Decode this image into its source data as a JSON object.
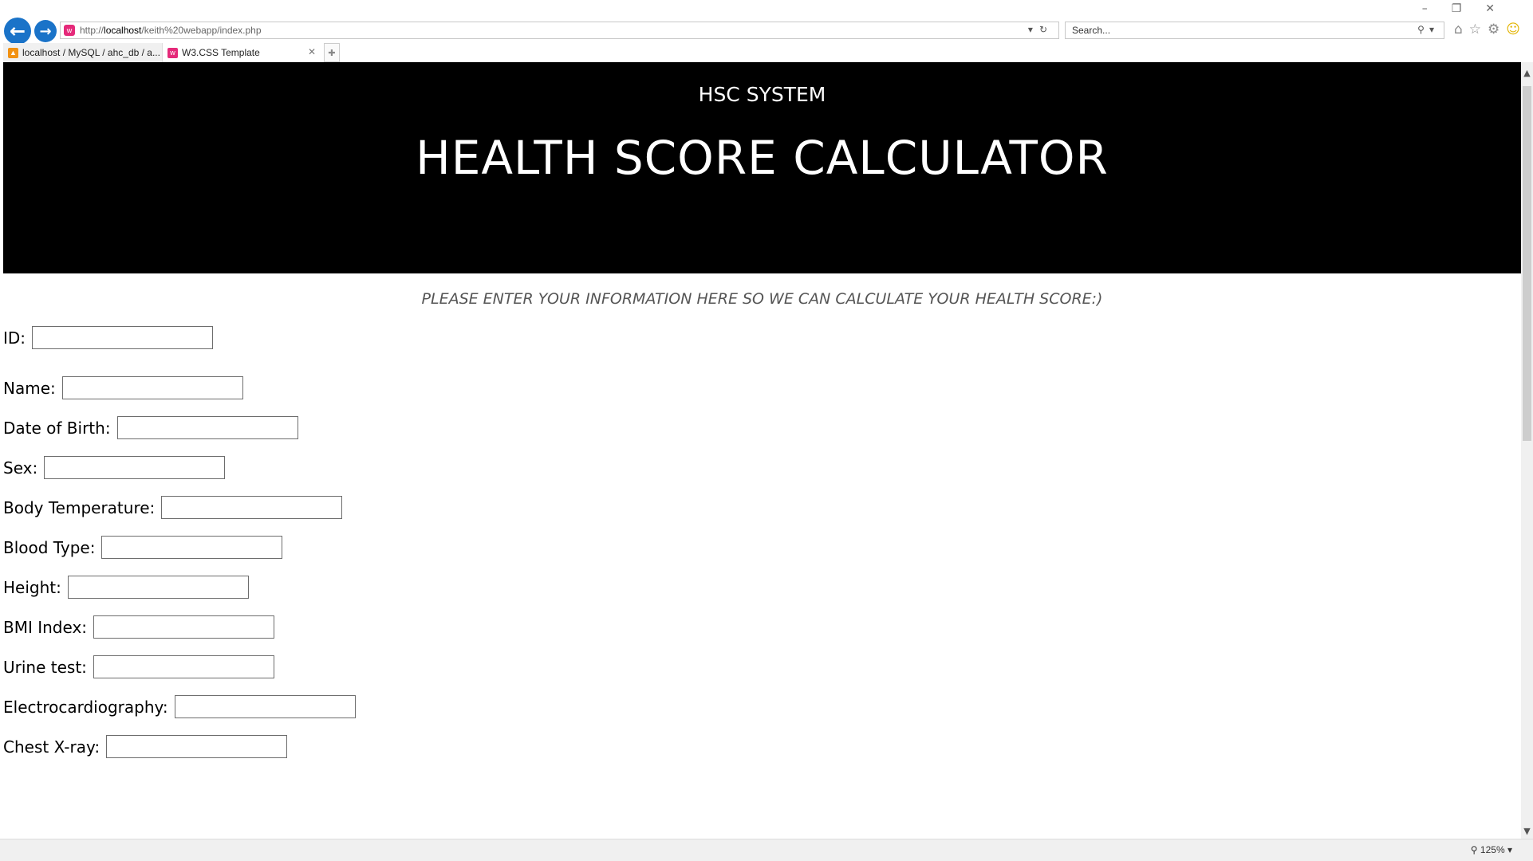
{
  "browser": {
    "address": {
      "prefix": "http://",
      "host": "localhost",
      "path": "/keith%20webapp/index.php"
    },
    "search_placeholder": "Search...",
    "tabs": [
      {
        "label": "localhost / MySQL / ahc_db / a..."
      },
      {
        "label": "W3.CSS Template"
      }
    ],
    "zoom": "125%"
  },
  "header": {
    "system": "HSC SYSTEM",
    "title": "HEALTH SCORE CALCULATOR"
  },
  "intro": "PLEASE ENTER YOUR INFORMATION HERE SO WE CAN CALCULATE YOUR HEALTH SCORE:)",
  "form": {
    "fields": [
      {
        "label": "ID:",
        "value": ""
      },
      {
        "label": "Name:",
        "value": ""
      },
      {
        "label": "Date of Birth:",
        "value": ""
      },
      {
        "label": "Sex:",
        "value": ""
      },
      {
        "label": "Body Temperature:",
        "value": ""
      },
      {
        "label": "Blood Type:",
        "value": ""
      },
      {
        "label": "Height:",
        "value": ""
      },
      {
        "label": "BMI Index:",
        "value": ""
      },
      {
        "label": "Urine test:",
        "value": ""
      },
      {
        "label": "Electrocardiography:",
        "value": ""
      },
      {
        "label": "Chest X-ray:",
        "value": ""
      }
    ]
  }
}
